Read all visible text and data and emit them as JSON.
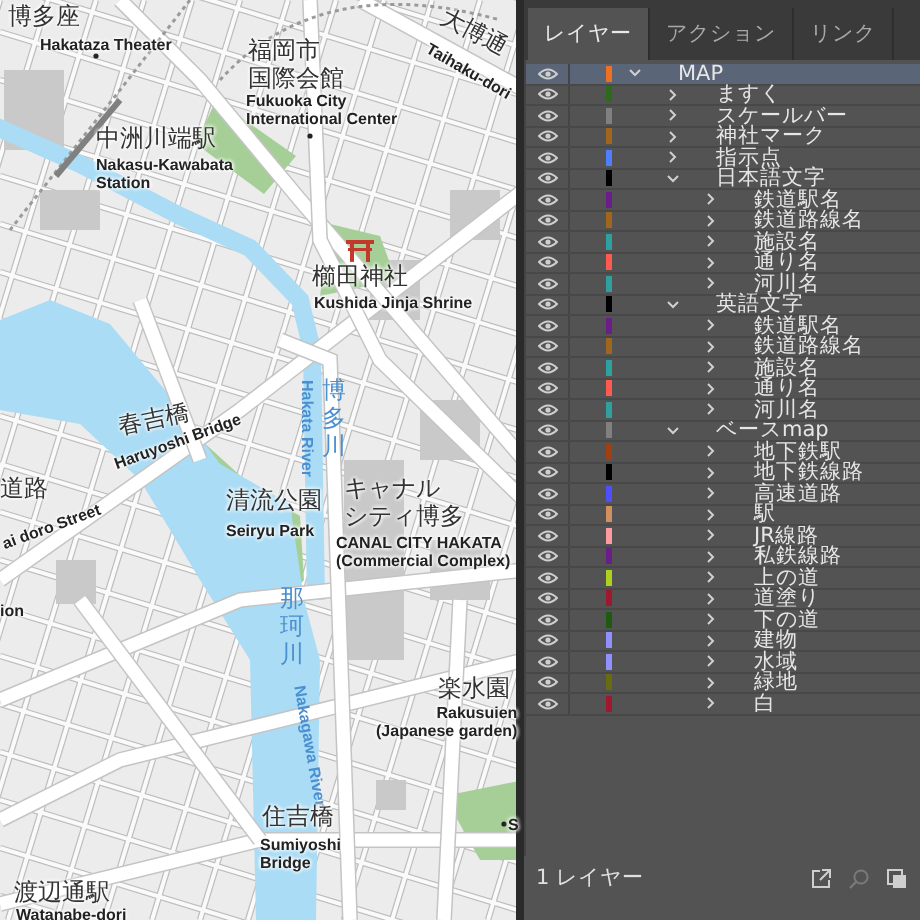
{
  "map": {
    "labels": [
      {
        "kind": "ja",
        "text": "博多座"
      },
      {
        "kind": "en",
        "text": "Hakataza Theater"
      },
      {
        "kind": "ja",
        "text": "福岡市"
      },
      {
        "kind": "ja",
        "text": "国際会館"
      },
      {
        "kind": "en",
        "text": "Fukuoka City\nInternational Center"
      },
      {
        "kind": "ja",
        "text": "大博通"
      },
      {
        "kind": "en",
        "text": "Taihaku-dori"
      },
      {
        "kind": "ja",
        "text": "中洲川端駅"
      },
      {
        "kind": "en",
        "text": "Nakasu-Kawabata\nStation"
      },
      {
        "kind": "ja",
        "text": "櫛田神社"
      },
      {
        "kind": "en",
        "text": "Kushida Jinja Shrine"
      },
      {
        "kind": "river-ja",
        "text": "博多川"
      },
      {
        "kind": "river-en",
        "text": "Hakata River"
      },
      {
        "kind": "ja",
        "text": "春吉橋"
      },
      {
        "kind": "en",
        "text": "Haruyoshi Bridge"
      },
      {
        "kind": "ja",
        "text": "道路"
      },
      {
        "kind": "en",
        "text": "ai doro Street"
      },
      {
        "kind": "ja",
        "text": "清流公園"
      },
      {
        "kind": "en",
        "text": "Seiryu Park"
      },
      {
        "kind": "ja",
        "text": "キャナル"
      },
      {
        "kind": "ja",
        "text": "シティ博多"
      },
      {
        "kind": "en",
        "text": "CANAL CITY HAKATA\n(Commercial Complex)"
      },
      {
        "kind": "river-ja",
        "text": "那珂川"
      },
      {
        "kind": "river-en",
        "text": "Nakagawa River"
      },
      {
        "kind": "ja",
        "text": "楽水園"
      },
      {
        "kind": "en",
        "text": "Rakusuien\n(Japanese garden)"
      },
      {
        "kind": "ja",
        "text": "住吉橋"
      },
      {
        "kind": "en",
        "text": "Sumiyoshi\nBridge"
      },
      {
        "kind": "ja",
        "text": "渡辺通駅"
      },
      {
        "kind": "en",
        "text": "ion"
      },
      {
        "kind": "en",
        "text": "Watanabe-dori"
      },
      {
        "kind": "en",
        "text": "S"
      }
    ]
  },
  "panel": {
    "tabs": [
      {
        "label": "レイヤー",
        "selected": true
      },
      {
        "label": "アクション",
        "selected": false
      },
      {
        "label": "リンク",
        "selected": false
      }
    ],
    "layers": [
      {
        "name": "MAP",
        "color": "#f07020",
        "visible": true,
        "expanded": true,
        "selected": true,
        "children": [
          {
            "name": "ますく",
            "color": "#2d6a1e",
            "visible": true,
            "expanded": false,
            "selected": false
          },
          {
            "name": "スケールバー",
            "color": "#808080",
            "visible": true,
            "expanded": false,
            "selected": false
          },
          {
            "name": "神社マーク",
            "color": "#a0661e",
            "visible": true,
            "expanded": false,
            "selected": false
          },
          {
            "name": "指示点",
            "color": "#4f7fff",
            "visible": true,
            "expanded": false,
            "selected": false
          },
          {
            "name": "日本語文字",
            "color": "#000000",
            "visible": true,
            "expanded": true,
            "selected": false,
            "children": [
              {
                "name": "鉄道駅名",
                "color": "#6b1d8a",
                "visible": true,
                "expanded": false,
                "selected": false
              },
              {
                "name": "鉄道路線名",
                "color": "#a0661e",
                "visible": true,
                "expanded": false,
                "selected": false
              },
              {
                "name": "施設名",
                "color": "#2fa0a0",
                "visible": true,
                "expanded": false,
                "selected": false
              },
              {
                "name": "通り名",
                "color": "#ff5a50",
                "visible": true,
                "expanded": false,
                "selected": false
              },
              {
                "name": "河川名",
                "color": "#2fa0a0",
                "visible": true,
                "expanded": false,
                "selected": false
              }
            ]
          },
          {
            "name": "英語文字",
            "color": "#000000",
            "visible": true,
            "expanded": true,
            "selected": false,
            "children": [
              {
                "name": "鉄道駅名",
                "color": "#6b1d8a",
                "visible": true,
                "expanded": false,
                "selected": false
              },
              {
                "name": "鉄道路線名",
                "color": "#a0661e",
                "visible": true,
                "expanded": false,
                "selected": false
              },
              {
                "name": "施設名",
                "color": "#2fa0a0",
                "visible": true,
                "expanded": false,
                "selected": false
              },
              {
                "name": "通り名",
                "color": "#ff5a50",
                "visible": true,
                "expanded": false,
                "selected": false
              },
              {
                "name": "河川名",
                "color": "#2fa0a0",
                "visible": true,
                "expanded": false,
                "selected": false
              }
            ]
          },
          {
            "name": "ベースmap",
            "color": "#808080",
            "visible": true,
            "expanded": true,
            "selected": false,
            "children": [
              {
                "name": "地下鉄駅",
                "color": "#a04010",
                "visible": true,
                "expanded": false,
                "selected": false
              },
              {
                "name": "地下鉄線路",
                "color": "#000000",
                "visible": true,
                "expanded": false,
                "selected": false
              },
              {
                "name": "高速道路",
                "color": "#4f4fff",
                "visible": true,
                "expanded": false,
                "selected": false
              },
              {
                "name": "駅",
                "color": "#d09060",
                "visible": true,
                "expanded": false,
                "selected": false
              },
              {
                "name": "JR線路",
                "color": "#ff9aa0",
                "visible": true,
                "expanded": false,
                "selected": false
              },
              {
                "name": "私鉄線路",
                "color": "#6b1d8a",
                "visible": true,
                "expanded": false,
                "selected": false
              },
              {
                "name": "上の道",
                "color": "#b0d020",
                "visible": true,
                "expanded": false,
                "selected": false
              },
              {
                "name": "道塗り",
                "color": "#a01830",
                "visible": true,
                "expanded": false,
                "selected": false
              },
              {
                "name": "下の道",
                "color": "#1e5a10",
                "visible": true,
                "expanded": false,
                "selected": false
              },
              {
                "name": "建物",
                "color": "#9090ff",
                "visible": true,
                "expanded": false,
                "selected": false
              },
              {
                "name": "水域",
                "color": "#9090ff",
                "visible": true,
                "expanded": false,
                "selected": false
              },
              {
                "name": "緑地",
                "color": "#6a6a10",
                "visible": true,
                "expanded": false,
                "selected": false
              },
              {
                "name": "白",
                "color": "#a01830",
                "visible": true,
                "expanded": false,
                "selected": false
              }
            ]
          }
        ]
      }
    ],
    "footer": {
      "count": "1 レイヤー"
    }
  }
}
